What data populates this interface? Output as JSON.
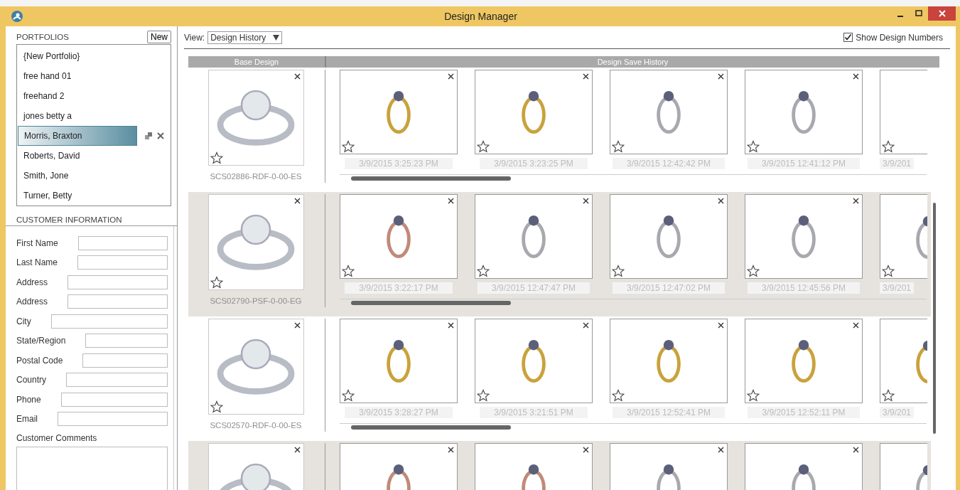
{
  "window": {
    "title": "Design Manager"
  },
  "portfolios": {
    "heading": "PORTFOLIOS",
    "new_button": "New",
    "items": [
      {
        "label": "{New Portfolio}",
        "selected": false
      },
      {
        "label": "free hand 01",
        "selected": false
      },
      {
        "label": "freehand 2",
        "selected": false
      },
      {
        "label": "jones betty a",
        "selected": false
      },
      {
        "label": "Morris, Braxton",
        "selected": true
      },
      {
        "label": "Roberts, David",
        "selected": false
      },
      {
        "label": "Smith, Jone",
        "selected": false
      },
      {
        "label": "Turner, Betty",
        "selected": false
      }
    ]
  },
  "customer_information": {
    "heading": "CUSTOMER INFORMATION",
    "fields": [
      {
        "label": "First Name"
      },
      {
        "label": "Last Name"
      },
      {
        "label": "Address"
      },
      {
        "label": "Address"
      },
      {
        "label": "City"
      },
      {
        "label": "State/Region"
      },
      {
        "label": "Postal Code"
      },
      {
        "label": "Country"
      },
      {
        "label": "Phone"
      },
      {
        "label": "Email"
      }
    ],
    "comments_label": "Customer Comments"
  },
  "view": {
    "label": "View:",
    "value": "Design History"
  },
  "show_design_numbers": {
    "label": "Show Design Numbers",
    "checked": true
  },
  "columns": [
    "Base Design",
    "Design Save History"
  ],
  "designs": [
    {
      "design_number": "SCS02886-RDF-0-00-ES",
      "history": [
        {
          "date": "3/9/2015 3:25:23 PM",
          "color": "#c9a23c"
        },
        {
          "date": "3/9/2015 3:23:25 PM",
          "color": "#c9a23c"
        },
        {
          "date": "3/9/2015 12:42:42 PM",
          "color": "#a7a9ae"
        },
        {
          "date": "3/9/2015 12:41:12 PM",
          "color": "#a7a9ae"
        },
        {
          "date": "3/9/201"
        }
      ]
    },
    {
      "design_number": "SCS02790-PSF-0-00-EG",
      "history": [
        {
          "date": "3/9/2015 3:22:17 PM",
          "color": "#c08a7a"
        },
        {
          "date": "3/9/2015 12:47:47 PM",
          "color": "#a7a9ae"
        },
        {
          "date": "3/9/2015 12:47:02 PM",
          "color": "#a7a9ae"
        },
        {
          "date": "3/9/2015 12:45:56 PM",
          "color": "#a7a9ae"
        },
        {
          "date": "3/9/201",
          "color": "#a7a9ae"
        }
      ]
    },
    {
      "design_number": "SCS02570-RDF-0-00-ES",
      "history": [
        {
          "date": "3/9/2015 3:28:27 PM",
          "color": "#c9a23c"
        },
        {
          "date": "3/9/2015 3:21:51 PM",
          "color": "#c9a23c"
        },
        {
          "date": "3/9/2015 12:52:41 PM",
          "color": "#c9a23c"
        },
        {
          "date": "3/9/2015 12:52:11 PM",
          "color": "#c9a23c"
        },
        {
          "date": "3/9/201",
          "color": "#c9a23c"
        }
      ]
    },
    {
      "history": [
        {
          "color": "#c08a7a"
        },
        {
          "color": "#c08a7a"
        },
        {
          "color": "#a7a9ae"
        },
        {
          "color": "#a7a9ae"
        },
        {
          "color": "#a7a9ae"
        }
      ]
    }
  ]
}
